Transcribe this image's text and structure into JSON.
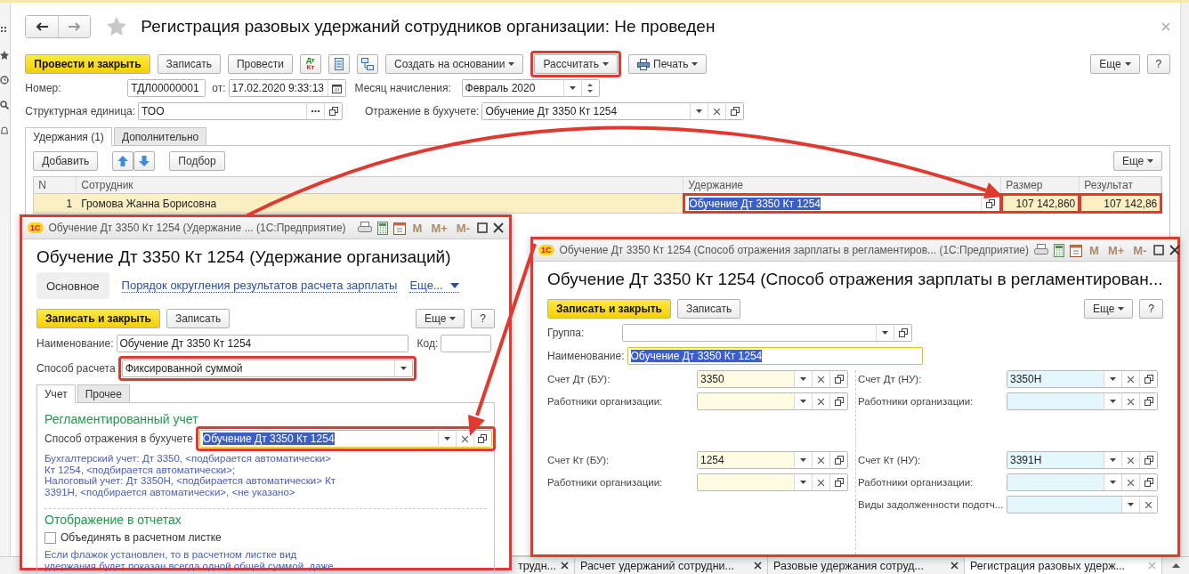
{
  "window": {
    "title": "Регистрация разовых удержаний сотрудников организации: Не проведен",
    "toolbar": [
      {
        "kind": "primary",
        "label": "Провести и закрыть"
      },
      {
        "kind": "plain",
        "label": "Записать"
      },
      {
        "kind": "plain",
        "label": "Провести"
      },
      {
        "kind": "dtkt",
        "label": "Дт",
        "label2": "Кт"
      },
      {
        "kind": "list"
      },
      {
        "kind": "structure"
      },
      {
        "kind": "menu",
        "label": "Создать на основании"
      },
      {
        "kind": "menu",
        "label": "Рассчитать",
        "highlight": true
      },
      {
        "kind": "print",
        "label": "Печать"
      }
    ],
    "more": "Еще",
    "help": "?",
    "header_rows": [
      [
        {
          "label": "Номер:",
          "value": "ТДЛ00000001",
          "kind": "plain"
        },
        {
          "label": "от:",
          "value": "17.02.2020  9:33:13",
          "kind": "date"
        },
        {
          "label": "Месяц начисления:",
          "value": "Февраль 2020",
          "kind": "month"
        }
      ],
      [
        {
          "label": "Структурная единица:",
          "value": "ТОО",
          "kind": "choose"
        },
        {
          "label": "Отражение в бухучете:",
          "value": "Обучение Дт 3350 Кт 1254",
          "kind": "ref"
        }
      ]
    ],
    "tabs": [
      {
        "label": "Удержания (1)",
        "selected": true
      },
      {
        "label": "Дополнительно",
        "selected": false
      }
    ],
    "table_toolbar": {
      "add": "Добавить",
      "pick": "Подбор",
      "more": "Еще"
    },
    "table": {
      "columns": [
        "N",
        "Сотрудник",
        "Удержание",
        "Размер",
        "Результат"
      ],
      "rows": [
        {
          "selected": true,
          "cells": [
            {
              "text": "1"
            },
            {
              "text": "Громова Жанна Борисовна"
            },
            {
              "text": "Обучение Дт 3350 Кт 1254",
              "kind": "editing",
              "highlight": true
            },
            {
              "text": "107 142,860",
              "highlight": true
            },
            {
              "text": "107 142,86",
              "highlight": true
            }
          ]
        }
      ]
    }
  },
  "deduction_window": {
    "highlight": true,
    "logo": "1С",
    "titlebar": "Обучение Дт 3350 Кт 1254 (Удержание ...  (1С:Предприятие)",
    "memory_buttons": [
      {
        "label": "M",
        "disabled": true
      },
      {
        "label": "M+",
        "disabled": true
      },
      {
        "label": "M-",
        "disabled": true
      }
    ],
    "heading": "Обучение Дт 3350 Кт 1254 (Удержание организаций)",
    "nav": [
      {
        "kind": "tab",
        "label": "Основное",
        "selected": true
      },
      {
        "kind": "link",
        "label": "Порядок округления результатов расчета зарплаты",
        "selected": false
      },
      {
        "kind": "menu",
        "label": "Еще...",
        "selected": false
      }
    ],
    "save_close": "Записать и закрыть",
    "save": "Записать",
    "more": "Еще",
    "help": "?",
    "name": {
      "label": "Наименование:",
      "value": "Обучение Дт 3350 Кт 1254",
      "kind": "plain"
    },
    "code": {
      "label": "Код:",
      "kind": "plain"
    },
    "method": {
      "label": "Способ расчета",
      "value": "Фиксированной суммой",
      "kind": "select",
      "highlight": true
    },
    "tabs": [
      {
        "label": "Учет",
        "selected": true
      },
      {
        "label": "Прочее",
        "selected": false
      }
    ],
    "accounting_title": "Регламентированный учет",
    "posting": {
      "label": "Способ отражения в бухучете",
      "value": "Обучение Дт 3350 Кт 1254",
      "kind": "ref",
      "focused": true,
      "highlight": true
    },
    "posting_note": [
      "Бухгалтерский учет: Дт 3350, <подбирается автоматически>",
      "Кт 1254, <подбирается автоматически>;",
      "Налоговый учет: Дт 3350Н, <подбирается автоматически> Кт",
      "3391Н, <подбирается автоматически>, <не указано>"
    ],
    "reports_title": "Отображение в отчетах",
    "combine": {
      "label": "Объединять в расчетном листке",
      "checked": false
    },
    "combine_note": [
      "Если флажок установлен, то в расчетном листке вид",
      "удержания будет показан всегда одной общей суммой, даже"
    ]
  },
  "posting_window": {
    "highlight": true,
    "logo": "1С",
    "titlebar": "Обучение Дт 3350 Кт 1254 (Способ отражения зарплаты в регламентиров...  (1С:Предприятие)",
    "memory_buttons": [
      {
        "label": "M",
        "disabled": true
      },
      {
        "label": "M+",
        "disabled": true
      },
      {
        "label": "M-",
        "disabled": true
      }
    ],
    "heading": "Обучение Дт 3350 Кт 1254 (Способ отражения зарплаты в регламентирован...",
    "save_close": "Записать и закрыть",
    "save": "Записать",
    "more": "Еще",
    "help": "?",
    "group": {
      "label": "Группа:",
      "kind": "select_open"
    },
    "name": {
      "label": "Наименование:",
      "value": "Обучение Дт 3350 Кт 1254",
      "kind": "plain",
      "focused": true
    },
    "columns": [
      {
        "kind": "bu",
        "groups": [
          {
            "fields": [
              {
                "label": "Счет Дт (БУ):",
                "value": "3350",
                "kind": "ref"
              },
              {
                "label": "Работники организации:",
                "kind": "ref"
              }
            ]
          },
          {
            "fields": [
              {
                "label": "Счет Кт (БУ):",
                "value": "1254",
                "kind": "ref"
              },
              {
                "label": "Работники организации:",
                "kind": "ref"
              }
            ]
          }
        ]
      },
      {
        "kind": "nu",
        "groups": [
          {
            "fields": [
              {
                "label": "Счет Дт (НУ):",
                "value": "3350Н",
                "kind": "ref"
              },
              {
                "label": "Работники организации:",
                "kind": "ref"
              }
            ]
          },
          {
            "fields": [
              {
                "label": "Счет Кт (НУ):",
                "value": "3391Н",
                "kind": "ref"
              },
              {
                "label": "Работники организации:",
                "kind": "ref"
              },
              {
                "label": "Виды задолженности подотч...",
                "kind": "ref_noopen"
              }
            ]
          }
        ]
      }
    ]
  },
  "open_tabs": [
    {
      "label": "трудн...",
      "selected": false
    },
    {
      "label": "Расчет удержаний сотрудни...",
      "selected": false
    },
    {
      "label": "Разовые удержания сотруд...",
      "selected": false
    },
    {
      "label": "Регистрация разовых удерж...",
      "selected": true
    }
  ]
}
